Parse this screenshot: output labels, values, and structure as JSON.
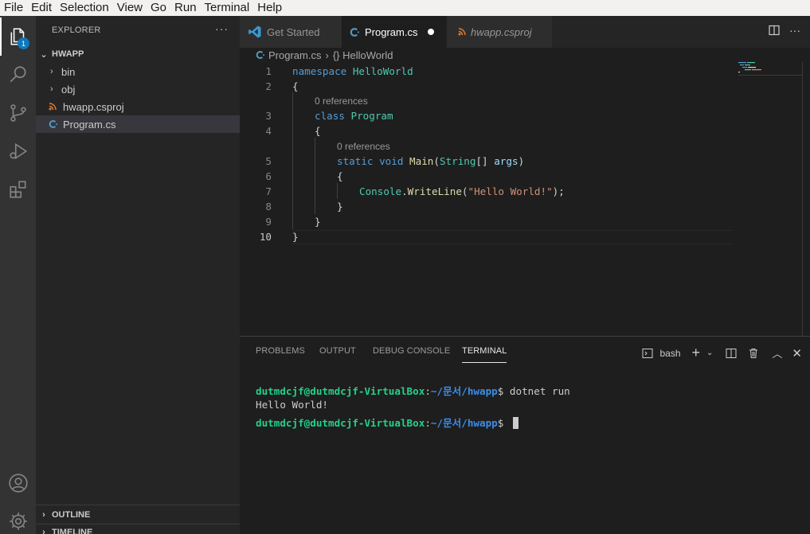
{
  "menubar": [
    "File",
    "Edit",
    "Selection",
    "View",
    "Go",
    "Run",
    "Terminal",
    "Help"
  ],
  "activity": {
    "explorer_badge": "1"
  },
  "sidebar": {
    "title": "EXPLORER",
    "more": "···",
    "folder": "HWAPP",
    "items": [
      {
        "label": "bin",
        "type": "folder"
      },
      {
        "label": "obj",
        "type": "folder"
      },
      {
        "label": "hwapp.csproj",
        "type": "rss-file"
      },
      {
        "label": "Program.cs",
        "type": "csharp-file"
      }
    ],
    "outline": "OUTLINE",
    "timeline": "TIMELINE"
  },
  "tabs": [
    {
      "label": "Get Started"
    },
    {
      "label": "Program.cs"
    },
    {
      "label": "hwapp.csproj"
    }
  ],
  "breadcrumb": {
    "file": "Program.cs",
    "symbol": "{} HelloWorld"
  },
  "editor": {
    "line_numbers": [
      "1",
      "2",
      "3",
      "4",
      "5",
      "6",
      "7",
      "8",
      "9",
      "10"
    ],
    "lens_1": "0 references",
    "lens_2": "0 references",
    "code": {
      "l1_kw": "namespace",
      "l1_name": "HelloWorld",
      "l2": "{",
      "l3_kw": "class",
      "l3_name": "Program",
      "l4": "{",
      "l5_kw1": "static",
      "l5_kw2": "void",
      "l5_fn": "Main",
      "l5_p1": "(",
      "l5_type": "String",
      "l5_p2": "[] ",
      "l5_arg": "args",
      "l5_p3": ")",
      "l6": "{",
      "l7_cls": "Console",
      "l7_dot": ".",
      "l7_fn": "WriteLine",
      "l7_p1": "(",
      "l7_str": "\"Hello World!\"",
      "l7_p2": ");",
      "l8": "}",
      "l9": "}",
      "l10": "}"
    }
  },
  "panel": {
    "tabs": [
      "PROBLEMS",
      "OUTPUT",
      "DEBUG CONSOLE",
      "TERMINAL"
    ],
    "shell": "bash",
    "terminal": {
      "user": "dutmdcjf@dutmdcjf-VirtualBox",
      "colon": ":",
      "path": "~/문서/hwapp",
      "prompt": "$ ",
      "cmd": "dotnet run",
      "output": "Hello World!"
    }
  }
}
